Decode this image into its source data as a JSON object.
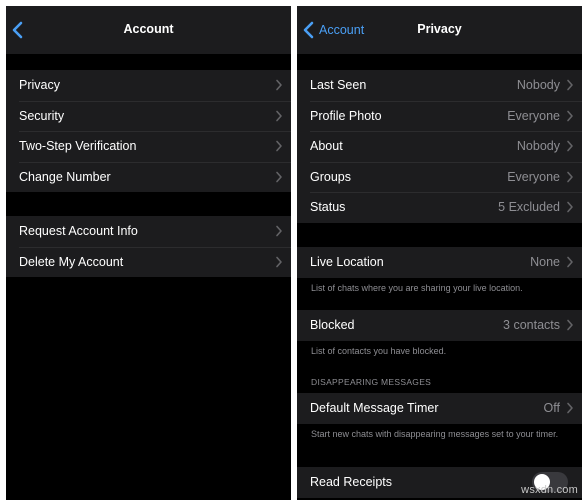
{
  "left": {
    "title": "Account",
    "group1": [
      {
        "label": "Privacy"
      },
      {
        "label": "Security"
      },
      {
        "label": "Two-Step Verification"
      },
      {
        "label": "Change Number"
      }
    ],
    "group2": [
      {
        "label": "Request Account Info"
      },
      {
        "label": "Delete My Account"
      }
    ]
  },
  "right": {
    "back_label": "Account",
    "title": "Privacy",
    "group1": [
      {
        "label": "Last Seen",
        "value": "Nobody"
      },
      {
        "label": "Profile Photo",
        "value": "Everyone"
      },
      {
        "label": "About",
        "value": "Nobody"
      },
      {
        "label": "Groups",
        "value": "Everyone"
      },
      {
        "label": "Status",
        "value": "5 Excluded"
      }
    ],
    "live_location": {
      "label": "Live Location",
      "value": "None",
      "footnote": "List of chats where you are sharing your live location."
    },
    "blocked": {
      "label": "Blocked",
      "value": "3 contacts",
      "footnote": "List of contacts you have blocked."
    },
    "disappearing": {
      "header": "DISAPPEARING MESSAGES",
      "label": "Default Message Timer",
      "value": "Off",
      "footnote": "Start new chats with disappearing messages set to your timer."
    },
    "read_receipts": {
      "label": "Read Receipts",
      "enabled": false
    }
  },
  "watermark": "wsxdn.com",
  "colors": {
    "background": "#000000",
    "cell": "#1c1c1e",
    "accent": "#4a9ff5",
    "secondary_text": "#8e8e93"
  }
}
